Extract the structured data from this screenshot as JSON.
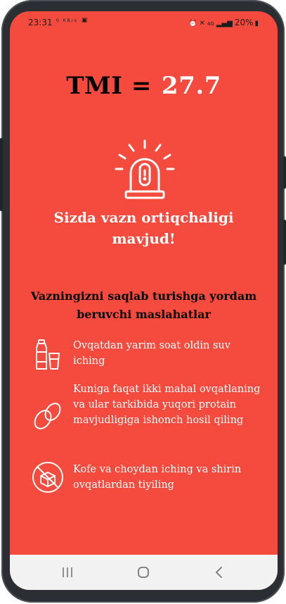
{
  "status_bar": {
    "time": "23:31",
    "left_icons": [
      "data-speed-icon",
      "image-icon"
    ],
    "data_speed": "0 KB/s",
    "network": "4G",
    "battery": "20%"
  },
  "result": {
    "label": "TMI =",
    "value": "27.7",
    "message": "Sizda vazn ortiqchaligi mavjud!"
  },
  "tips": {
    "heading": "Vazningizni saqlab turishga yordam beruvchi maslahatlar",
    "items": [
      {
        "icon": "water-bottle-glass-icon",
        "text": "Ovqatdan yarim soat oldin suv iching"
      },
      {
        "icon": "eggs-icon",
        "text": "Kuniga faqat ikki mahal ovqatlaning va ular tarkibida yuqori protain mavjudligiga ishonch hosil qiling"
      },
      {
        "icon": "no-sugar-icon",
        "text": "Kofe va choydan iching va shirin ovqatlardan tiyiling"
      }
    ]
  },
  "colors": {
    "background": "#f44b3e",
    "heading_text": "#000000",
    "body_text": "#ffffff"
  },
  "nav": {
    "recents_icon": "recent-apps-icon",
    "home_icon": "home-icon",
    "back_icon": "back-icon"
  }
}
